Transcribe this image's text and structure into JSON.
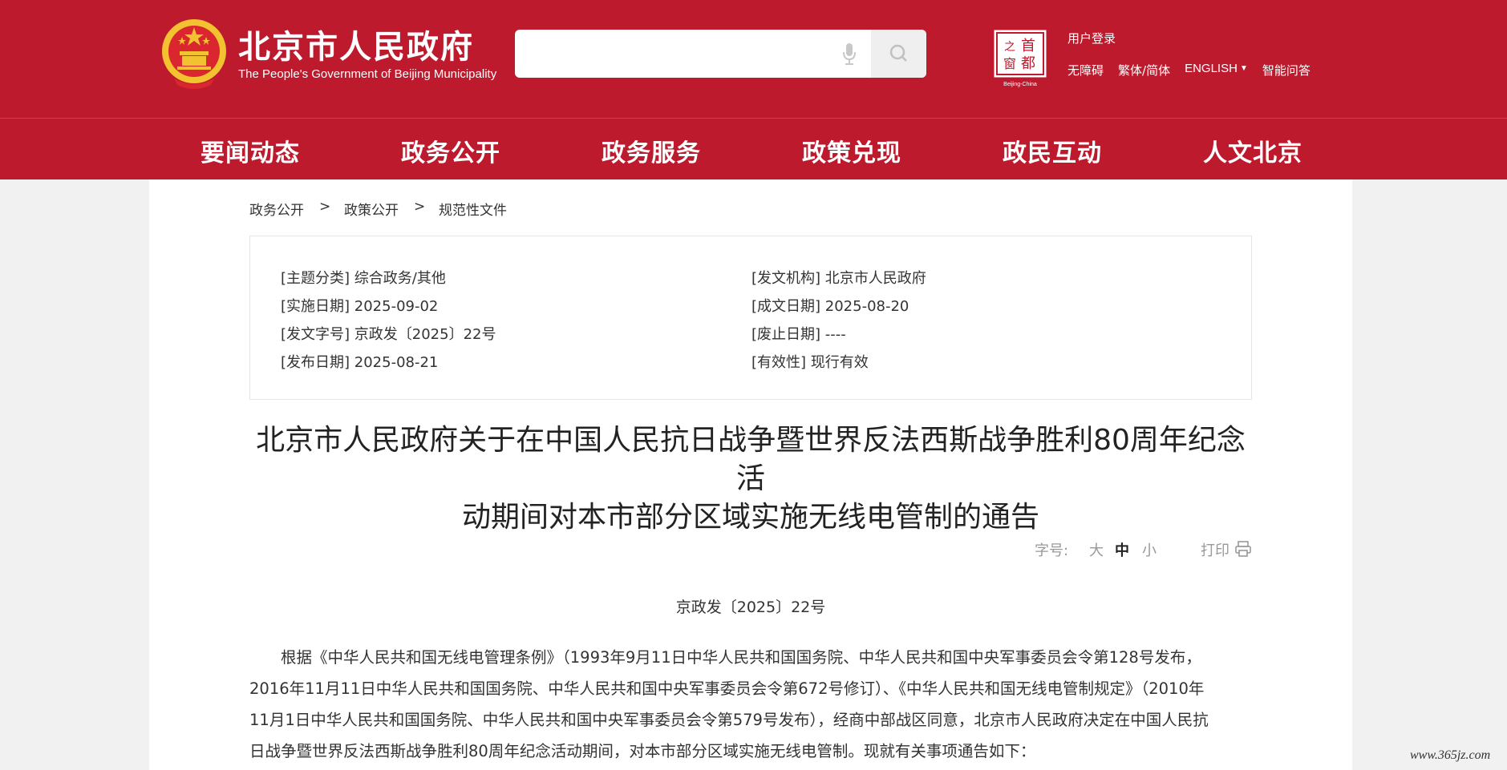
{
  "header": {
    "site_name": "北京市人民政府",
    "site_sub": "The People's Government of Beijing Municipality",
    "search_placeholder": "",
    "seal_chars": [
      "首",
      "都",
      "之",
      "窗"
    ],
    "seal_caption": "Beijing-China",
    "login": "用户登录",
    "links": [
      "无障碍",
      "繁体/简体",
      "ENGLISH",
      "智能问答"
    ],
    "english_arrow": "▼"
  },
  "nav": {
    "items": [
      "要闻动态",
      "政务公开",
      "政务服务",
      "政策兑现",
      "政民互动",
      "人文北京"
    ]
  },
  "breadcrumb": {
    "items": [
      "政务公开",
      "政策公开",
      "规范性文件"
    ],
    "separator": ">"
  },
  "meta": {
    "left": [
      {
        "label": "[主题分类]",
        "value": "综合政务/其他"
      },
      {
        "label": "[实施日期]",
        "value": "2025-09-02"
      },
      {
        "label": "[发文字号]",
        "value": "京政发〔2025〕22号"
      },
      {
        "label": "[发布日期]",
        "value": "2025-08-21"
      }
    ],
    "right": [
      {
        "label": "[发文机构]",
        "value": "北京市人民政府"
      },
      {
        "label": "[成文日期]",
        "value": "2025-08-20"
      },
      {
        "label": "[废止日期]",
        "value": "----"
      },
      {
        "label": "[有效性]",
        "value": "现行有效"
      }
    ]
  },
  "document": {
    "title_line1": "北京市人民政府关于在中国人民抗日战争暨世界反法西斯战争胜利80周年纪念活",
    "title_line2": "动期间对本市部分区域实施无线电管制的通告",
    "font_size_label": "字号:",
    "font_sizes": [
      "大",
      "中",
      "小"
    ],
    "font_size_selected": "中",
    "print_label": "打印",
    "doc_number": "京政发〔2025〕22号",
    "paragraph_lines": [
      "根据《中华人民共和国无线电管理条例》（1993年9月11日中华人民共和国国务院、中华人民共和国中央军事委员会令第128号发布，",
      "2016年11月11日中华人民共和国国务院、中华人民共和国中央军事委员会令第672号修订）、《中华人民共和国无线电管制规定》（2010年",
      "11月1日中华人民共和国国务院、中华人民共和国中央军事委员会令第579号发布），经商中部战区同意，北京市人民政府决定在中国人民抗",
      "日战争暨世界反法西斯战争胜利80周年纪念活动期间，对本市部分区域实施无线电管制。现就有关事项通告如下："
    ]
  },
  "watermark": "www.365jz.com",
  "colors": {
    "brand_red": "#bd1a2d",
    "page_bg": "#f1f1f1",
    "emblem_gold": "#f2c230"
  },
  "icons": [
    "national-emblem-icon",
    "microphone-icon",
    "search-icon",
    "capital-window-seal-icon",
    "printer-icon"
  ]
}
